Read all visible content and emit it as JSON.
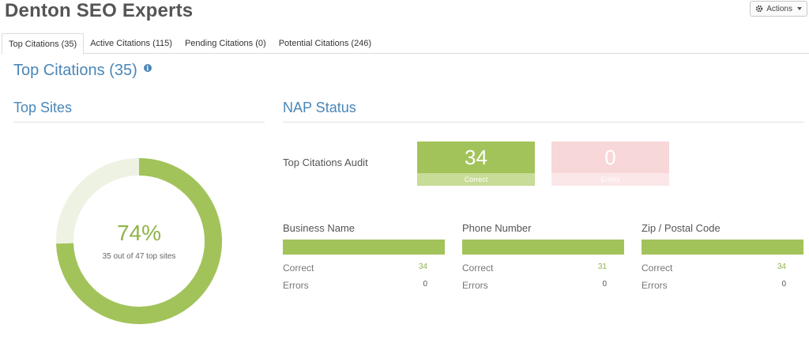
{
  "header": {
    "company": "Denton SEO Experts",
    "actions_label": "Actions"
  },
  "tabs": [
    {
      "label": "Top Citations (35)",
      "active": true
    },
    {
      "label": "Active Citations (115)",
      "active": false
    },
    {
      "label": "Pending Citations (0)",
      "active": false
    },
    {
      "label": "Potential Citations (246)",
      "active": false
    }
  ],
  "section": {
    "title": "Top Citations (35)"
  },
  "top_sites": {
    "title": "Top Sites",
    "percent_label": "74%",
    "subtitle": "35 out of 47 top sites",
    "fraction": 0.7447,
    "color_filled": "#a2c35a",
    "color_empty": "#eef2e3"
  },
  "nap_status": {
    "title": "NAP Status",
    "audit_label": "Top Citations Audit",
    "correct_box": {
      "value": "34",
      "caption": "Correct",
      "color": "#a2c35a"
    },
    "errors_box": {
      "value": "0",
      "caption": "Errors",
      "color": "#f7d7d8"
    },
    "metrics": [
      {
        "title": "Business Name",
        "correct_label": "Correct",
        "correct_value": "34",
        "errors_label": "Errors",
        "errors_value": "0"
      },
      {
        "title": "Phone Number",
        "correct_label": "Correct",
        "correct_value": "31",
        "errors_label": "Errors",
        "errors_value": "0"
      },
      {
        "title": "Zip / Postal Code",
        "correct_label": "Correct",
        "correct_value": "34",
        "errors_label": "Errors",
        "errors_value": "0"
      }
    ]
  }
}
